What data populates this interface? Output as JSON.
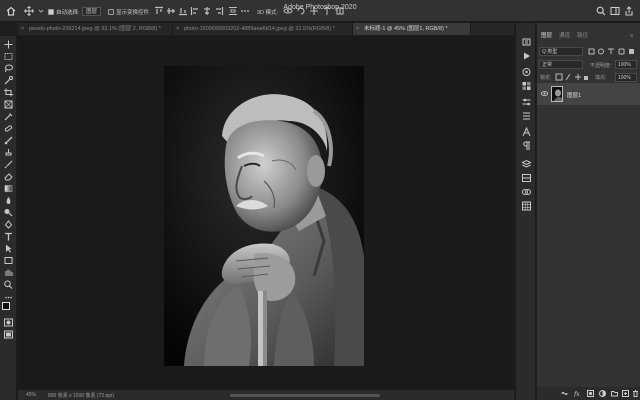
{
  "app": {
    "title": "Adobe Photoshop 2020"
  },
  "options_bar": {
    "auto_select_label": "自动选择:",
    "auto_select_checked": true,
    "auto_select_target": "图层",
    "show_transform_label": "显示变换控件",
    "show_transform_checked": false,
    "mode_3d_label": "3D 模式:"
  },
  "tabs": [
    {
      "label": "pexels-photo-236214.jpeg @ 32.1% (图层 2, RGB/8) *",
      "active": false
    },
    {
      "label": "photo-1509695603202-4889aea6d14.jpeg @ 31.5%(RGB/8) *",
      "active": false
    },
    {
      "label": "未标题-1 @ 45% (图层1, RGB/8) *",
      "active": true
    }
  ],
  "tools": [
    "move-icon",
    "marquee-icon",
    "lasso-icon",
    "quick-select-icon",
    "crop-icon",
    "frame-icon",
    "eyedropper-icon",
    "healing-brush-icon",
    "brush-icon",
    "clone-stamp-icon",
    "history-brush-icon",
    "eraser-icon",
    "gradient-icon",
    "blur-icon",
    "dodge-icon",
    "pen-icon",
    "type-icon",
    "path-select-icon",
    "rectangle-icon",
    "hand-icon",
    "zoom-icon"
  ],
  "status": {
    "zoom": "45%",
    "doc_info": "800 像素 x 1500 像素 (72 ppi)"
  },
  "panel": {
    "tabs": [
      "图层",
      "通道",
      "路径"
    ],
    "active_tab": 0,
    "filter_label": "Q 类型",
    "blend_mode": "正常",
    "opacity_label": "不透明度:",
    "opacity_value": "100%",
    "lock_label": "锁定:",
    "fill_label": "填充:",
    "fill_value": "100%",
    "layers": [
      {
        "name": "图层1",
        "visible": true
      }
    ]
  },
  "colors": {
    "accent": "#323232",
    "canvas_bg": "#1a1a1a",
    "panel_bg": "#323232"
  }
}
